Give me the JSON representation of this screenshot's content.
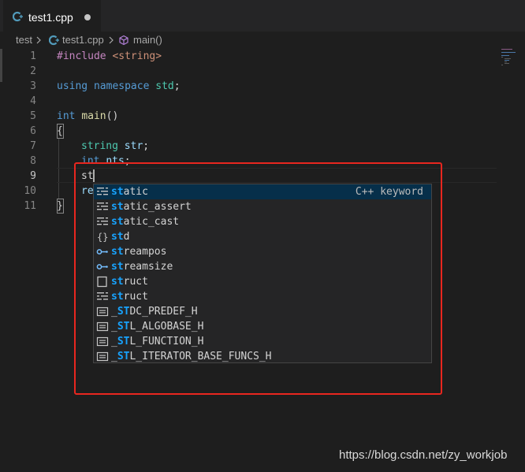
{
  "tab": {
    "filename": "test1.cpp",
    "icon": "cpp-file-icon",
    "modified": true
  },
  "breadcrumb": {
    "folder": "test",
    "file": "test1.cpp",
    "symbol": "main()"
  },
  "line_numbers": [
    "1",
    "2",
    "3",
    "4",
    "5",
    "6",
    "7",
    "8",
    "9",
    "10",
    "11"
  ],
  "code": {
    "l1_directive": "#include",
    "l1_header": "<string>",
    "l3_using": "using",
    "l3_namespace": "namespace",
    "l3_std": "std",
    "l3_semicolon": ";",
    "l5_int": "int",
    "l5_main": "main",
    "l5_parens": "()",
    "l6_brace": "{",
    "l7_type": "string",
    "l7_var": "str",
    "l7_semicolon": ";",
    "l8_int": "int",
    "l8_var": "nts",
    "l8_semicolon": ";",
    "l9_typed": "st",
    "l10_partial": "re",
    "l11_brace": "}"
  },
  "suggestions": [
    {
      "match": "st",
      "rest": "atic",
      "icon": "keyword-icon",
      "detail": "C++ keyword"
    },
    {
      "match": "st",
      "rest": "atic_assert",
      "icon": "keyword-icon"
    },
    {
      "match": "st",
      "rest": "atic_cast",
      "icon": "keyword-icon"
    },
    {
      "pre": "",
      "match": "st",
      "rest": "d",
      "icon": "namespace-icon"
    },
    {
      "match": "st",
      "rest": "reampos",
      "icon": "type-icon"
    },
    {
      "match": "st",
      "rest": "reamsize",
      "icon": "type-icon"
    },
    {
      "match": "st",
      "rest": "ruct",
      "icon": "struct-icon"
    },
    {
      "match": "st",
      "rest": "ruct",
      "icon": "keyword-icon"
    },
    {
      "pre": "_",
      "match": "ST",
      "rest": "DC_PREDEF_H",
      "icon": "constant-icon"
    },
    {
      "pre": "_",
      "match": "ST",
      "rest": "L_ALGOBASE_H",
      "icon": "constant-icon"
    },
    {
      "pre": "_",
      "match": "ST",
      "rest": "L_FUNCTION_H",
      "icon": "constant-icon"
    },
    {
      "pre": "_",
      "match": "ST",
      "rest": "L_ITERATOR_BASE_FUNCS_H",
      "icon": "constant-icon"
    }
  ],
  "watermark": "https://blog.csdn.net/zy_workjob",
  "colors": {
    "keyword": "#569cd6",
    "match_highlight": "#18a3ff",
    "selection": "#062f4a",
    "annotation_box": "#e8261f"
  }
}
